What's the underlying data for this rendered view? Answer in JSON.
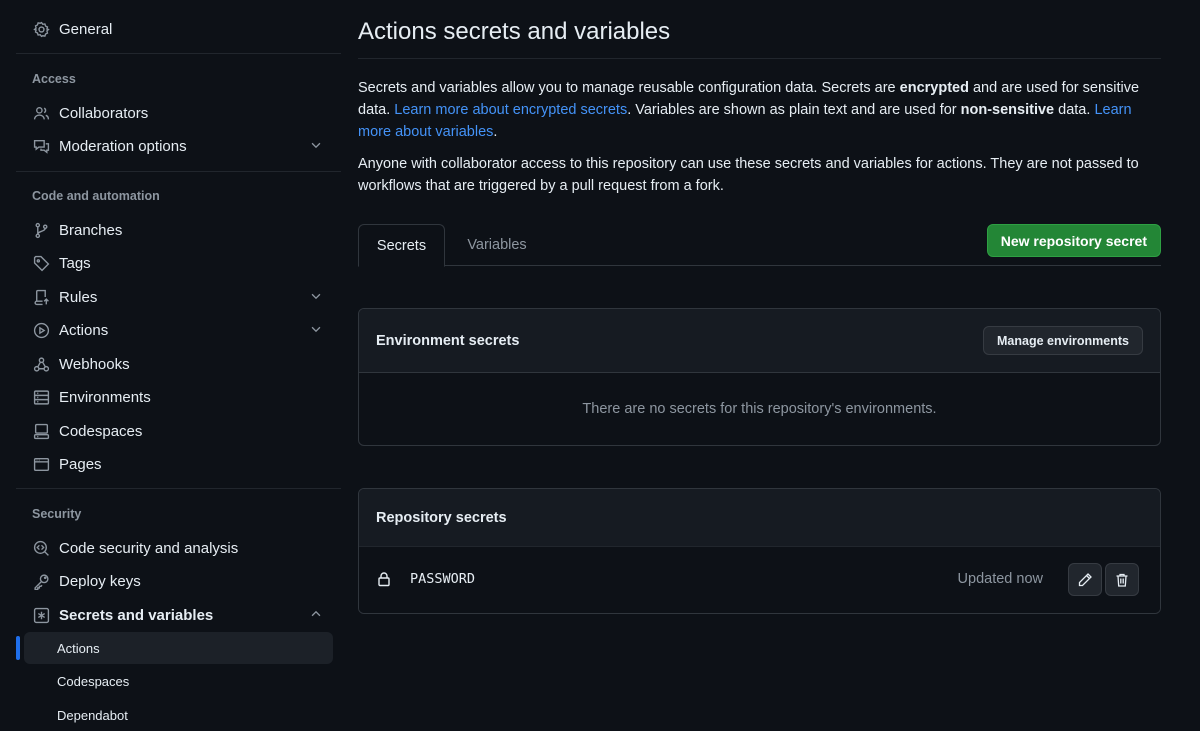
{
  "sidebar": {
    "general": "General",
    "access_header": "Access",
    "collaborators": "Collaborators",
    "moderation": "Moderation options",
    "code_header": "Code and automation",
    "branches": "Branches",
    "tags": "Tags",
    "rules": "Rules",
    "actions": "Actions",
    "webhooks": "Webhooks",
    "environments": "Environments",
    "codespaces": "Codespaces",
    "pages": "Pages",
    "security_header": "Security",
    "code_security": "Code security and analysis",
    "deploy_keys": "Deploy keys",
    "secrets_variables": "Secrets and variables",
    "sub_actions": "Actions",
    "sub_codespaces": "Codespaces",
    "sub_dependabot": "Dependabot"
  },
  "main": {
    "title": "Actions secrets and variables",
    "para1": {
      "t1": "Secrets and variables allow you to manage reusable configuration data. Secrets are ",
      "b1": "encrypted",
      "t2": " and are used for sensitive data. ",
      "link1": "Learn more about encrypted secrets",
      "t3": ". Variables are shown as plain text and are used for ",
      "b2": "non-sensitive",
      "t4": " data. ",
      "link2": "Learn more about variables",
      "t5": "."
    },
    "para2": "Anyone with collaborator access to this repository can use these secrets and variables for actions. They are not passed to workflows that are triggered by a pull request from a fork.",
    "tabs": [
      "Secrets",
      "Variables"
    ],
    "new_secret_button": "New repository secret",
    "env_secrets": {
      "title": "Environment secrets",
      "manage_button": "Manage environments",
      "empty": "There are no secrets for this repository's environments."
    },
    "repo_secrets": {
      "title": "Repository secrets",
      "items": [
        {
          "name": "PASSWORD",
          "updated": "Updated now"
        }
      ]
    }
  },
  "colors": {
    "background": "#0d1117",
    "accent_blue": "#1f6feb",
    "link": "#4493f8",
    "primary_green": "#238636"
  }
}
